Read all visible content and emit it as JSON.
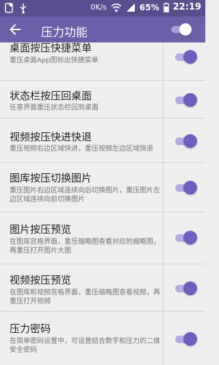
{
  "status_bar": {
    "network_speed": "0K/s",
    "battery_percent": "65%",
    "time": "22:19",
    "icons": [
      "notification-icon",
      "usb-icon",
      "wifi-icon",
      "signal-icon",
      "battery-icon"
    ]
  },
  "app_bar": {
    "title": "压力功能",
    "back_icon": "arrow-left-icon",
    "master_toggle_on": true
  },
  "colors": {
    "status_bar": "#5a4f8e",
    "app_bar": "#6b5fa7",
    "toggle_knob": "#6b5fbf",
    "toggle_track": "#b5acdf"
  },
  "items": [
    {
      "title": "桌面按压快捷菜单",
      "subtitle": "重压桌面App图标出快捷菜单",
      "enabled": true
    },
    {
      "title": "状态栏按压回桌面",
      "subtitle": "任意界面重压状态栏回到桌面",
      "enabled": true
    },
    {
      "title": "视频按压快进快退",
      "subtitle": "重压视频右边区域快进，重压视频左边区域快退",
      "enabled": true
    },
    {
      "title": "图库按压切换图片",
      "subtitle": "重压图片右边区域连续向后切换图片，重压图片左边区域连续向前切换图片",
      "enabled": true
    },
    {
      "title": "图片按压预览",
      "subtitle": "在图库宫格界面，重压缩略图查看对应的缩略图，再重压打开图片大图",
      "enabled": true
    },
    {
      "title": "视频按压预览",
      "subtitle": "在图库和视频宫格界面，重压缩略图查看视频，再重压打开视频",
      "enabled": true
    },
    {
      "title": "压力密码",
      "subtitle": "在简单密码设置中，可设置结合数字和压力的二维安全密码",
      "enabled": true
    }
  ]
}
